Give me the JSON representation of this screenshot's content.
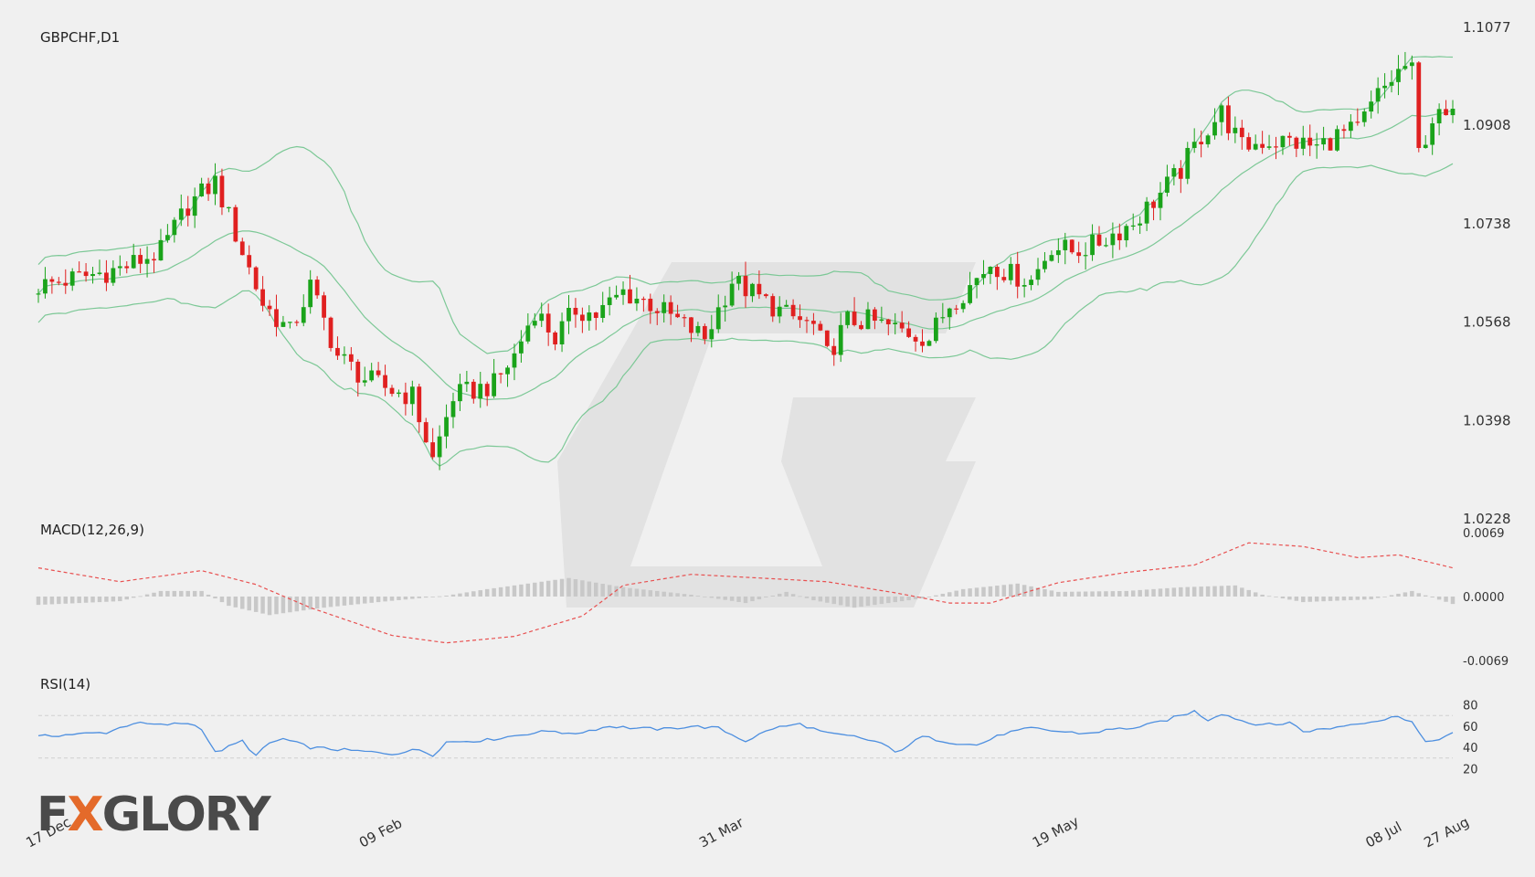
{
  "chart_data": [
    {
      "type": "candlestick",
      "title": "GBPCHF,D1",
      "x_tick_labels": [
        "17 Dec",
        "09 Feb",
        "31 Mar",
        "19 May",
        "08 Jul",
        "27 Aug"
      ],
      "y_tick_labels": [
        "1.1077",
        "1.0908",
        "1.0738",
        "1.0568",
        "1.0398",
        "1.0228"
      ],
      "ylim": [
        1.0228,
        1.1077
      ],
      "overlays": [
        "Bollinger Bands (upper)",
        "Bollinger Bands (middle)",
        "Bollinger Bands (lower)"
      ],
      "close_path": [
        [
          0,
          1.063
        ],
        [
          12,
          1.066
        ],
        [
          18,
          1.069
        ],
        [
          22,
          1.077
        ],
        [
          26,
          1.081
        ],
        [
          30,
          1.069
        ],
        [
          33,
          1.06
        ],
        [
          37,
          1.055
        ],
        [
          40,
          1.063
        ],
        [
          44,
          1.051
        ],
        [
          48,
          1.047
        ],
        [
          52,
          1.045
        ],
        [
          55,
          1.044
        ],
        [
          58,
          1.033
        ],
        [
          61,
          1.044
        ],
        [
          64,
          1.045
        ],
        [
          67,
          1.046
        ],
        [
          70,
          1.051
        ],
        [
          73,
          1.059
        ],
        [
          76,
          1.054
        ],
        [
          79,
          1.059
        ],
        [
          82,
          1.058
        ],
        [
          86,
          1.062
        ],
        [
          90,
          1.06
        ],
        [
          94,
          1.057
        ],
        [
          98,
          1.054
        ],
        [
          100,
          1.059
        ],
        [
          102,
          1.064
        ],
        [
          106,
          1.061
        ],
        [
          110,
          1.058
        ],
        [
          114,
          1.056
        ],
        [
          116,
          1.051
        ],
        [
          119,
          1.057
        ],
        [
          122,
          1.057
        ],
        [
          125,
          1.056
        ],
        [
          128,
          1.055
        ],
        [
          131,
          1.054
        ],
        [
          134,
          1.06
        ],
        [
          137,
          1.063
        ],
        [
          140,
          1.067
        ],
        [
          143,
          1.065
        ],
        [
          146,
          1.064
        ],
        [
          149,
          1.07
        ],
        [
          152,
          1.069
        ],
        [
          155,
          1.07
        ],
        [
          158,
          1.072
        ],
        [
          161,
          1.074
        ],
        [
          165,
          1.079
        ],
        [
          168,
          1.083
        ],
        [
          171,
          1.089
        ],
        [
          174,
          1.093
        ],
        [
          177,
          1.087
        ],
        [
          180,
          1.088
        ],
        [
          184,
          1.088
        ],
        [
          188,
          1.087
        ],
        [
          191,
          1.089
        ],
        [
          194,
          1.09
        ],
        [
          197,
          1.096
        ],
        [
          200,
          1.1
        ],
        [
          201,
          1.101
        ],
        [
          202,
          1.1
        ],
        [
          203,
          1.086
        ],
        [
          205,
          1.092
        ],
        [
          208,
          1.092
        ]
      ]
    },
    {
      "type": "line+bar",
      "title": "MACD(12,26,9)",
      "y_tick_labels": [
        "0.0069",
        "0.0000",
        "-0.0069"
      ],
      "ylim": [
        -0.0069,
        0.0069
      ],
      "signal_path": [
        [
          0,
          0.0031
        ],
        [
          12,
          0.0016
        ],
        [
          24,
          0.0028
        ],
        [
          32,
          0.0013
        ],
        [
          40,
          -0.0012
        ],
        [
          52,
          -0.0042
        ],
        [
          60,
          -0.005
        ],
        [
          70,
          -0.0043
        ],
        [
          80,
          -0.0021
        ],
        [
          86,
          0.0012
        ],
        [
          96,
          0.0024
        ],
        [
          106,
          0.002
        ],
        [
          116,
          0.0016
        ],
        [
          126,
          0.0004
        ],
        [
          134,
          -0.0007
        ],
        [
          140,
          -0.0007
        ],
        [
          150,
          0.0015
        ],
        [
          160,
          0.0026
        ],
        [
          170,
          0.0034
        ],
        [
          178,
          0.0058
        ],
        [
          186,
          0.0054
        ],
        [
          194,
          0.0042
        ],
        [
          200,
          0.0045
        ],
        [
          208,
          0.0031
        ]
      ],
      "histogram_path": [
        [
          0,
          -0.0009
        ],
        [
          12,
          -0.0005
        ],
        [
          18,
          0.0006
        ],
        [
          24,
          0.0006
        ],
        [
          28,
          -0.001
        ],
        [
          34,
          -0.002
        ],
        [
          42,
          -0.0012
        ],
        [
          50,
          -0.0006
        ],
        [
          60,
          0.0001
        ],
        [
          66,
          0.0008
        ],
        [
          72,
          0.0014
        ],
        [
          78,
          0.002
        ],
        [
          86,
          0.001
        ],
        [
          96,
          0.0002
        ],
        [
          104,
          -0.0007
        ],
        [
          110,
          0.0005
        ],
        [
          114,
          -0.0004
        ],
        [
          120,
          -0.0012
        ],
        [
          130,
          -0.0002
        ],
        [
          136,
          0.0008
        ],
        [
          144,
          0.0014
        ],
        [
          150,
          0.0005
        ],
        [
          160,
          0.0006
        ],
        [
          168,
          0.001
        ],
        [
          176,
          0.0012
        ],
        [
          180,
          0.0002
        ],
        [
          186,
          -0.0006
        ],
        [
          196,
          -0.0003
        ],
        [
          202,
          0.0006
        ],
        [
          208,
          -0.0008
        ]
      ]
    },
    {
      "type": "line",
      "title": "RSI(14)",
      "y_tick_labels": [
        "80",
        "60",
        "40",
        "20"
      ],
      "ylim": [
        10,
        90
      ],
      "reference_lines": [
        70,
        30
      ],
      "values_path": [
        [
          0,
          50
        ],
        [
          4,
          52
        ],
        [
          10,
          54
        ],
        [
          14,
          63
        ],
        [
          18,
          61
        ],
        [
          22,
          63
        ],
        [
          24,
          58
        ],
        [
          26,
          35
        ],
        [
          30,
          46
        ],
        [
          32,
          32
        ],
        [
          34,
          44
        ],
        [
          36,
          48
        ],
        [
          40,
          40
        ],
        [
          46,
          37
        ],
        [
          52,
          34
        ],
        [
          56,
          38
        ],
        [
          58,
          33
        ],
        [
          60,
          45
        ],
        [
          66,
          47
        ],
        [
          72,
          53
        ],
        [
          76,
          56
        ],
        [
          78,
          52
        ],
        [
          84,
          60
        ],
        [
          88,
          58
        ],
        [
          92,
          57
        ],
        [
          96,
          60
        ],
        [
          100,
          58
        ],
        [
          104,
          46
        ],
        [
          108,
          58
        ],
        [
          112,
          62
        ],
        [
          116,
          53
        ],
        [
          120,
          50
        ],
        [
          124,
          44
        ],
        [
          126,
          35
        ],
        [
          130,
          50
        ],
        [
          134,
          45
        ],
        [
          138,
          42
        ],
        [
          142,
          53
        ],
        [
          146,
          58
        ],
        [
          150,
          55
        ],
        [
          154,
          53
        ],
        [
          158,
          57
        ],
        [
          162,
          59
        ],
        [
          166,
          66
        ],
        [
          170,
          74
        ],
        [
          172,
          66
        ],
        [
          174,
          72
        ],
        [
          178,
          63
        ],
        [
          182,
          61
        ],
        [
          184,
          64
        ],
        [
          186,
          55
        ],
        [
          190,
          58
        ],
        [
          194,
          63
        ],
        [
          198,
          66
        ],
        [
          200,
          70
        ],
        [
          202,
          64
        ],
        [
          204,
          44
        ],
        [
          208,
          53
        ]
      ]
    }
  ],
  "branding": {
    "logo_text_pre": "F",
    "logo_text_x": "X",
    "logo_text_post": "GLORY"
  },
  "colors": {
    "bull": "#1aa31a",
    "bear": "#e02020",
    "band": "#7cc896",
    "macd_hist": "#c8c8c8",
    "macd_signal": "#e85050",
    "rsi": "#4d8fe0",
    "watermark": "#e2e2e2"
  }
}
